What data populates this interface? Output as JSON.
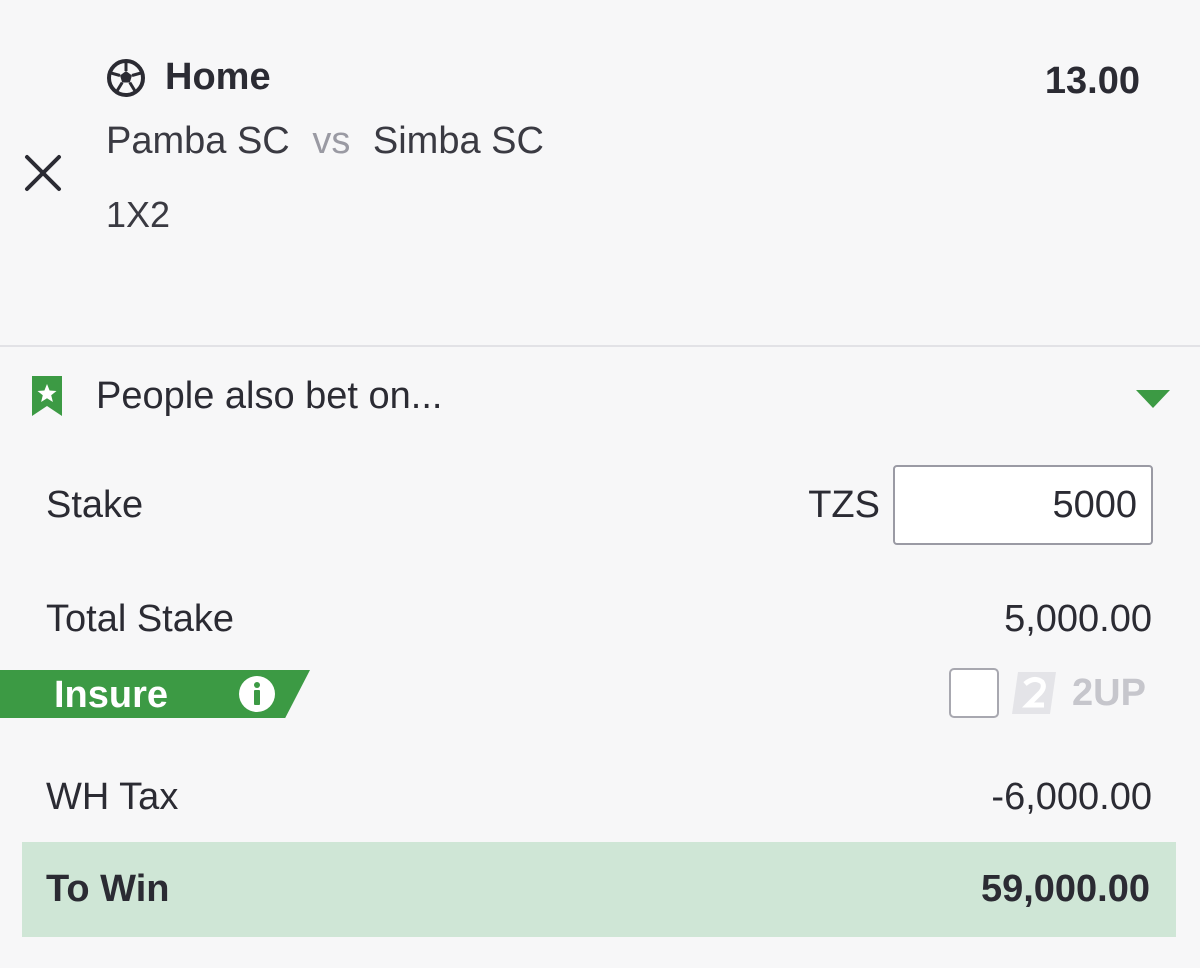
{
  "selection": {
    "sport_icon": "soccer-ball-icon",
    "pick": "Home",
    "odds": "13.00",
    "home_team": "Pamba SC",
    "vs": "vs",
    "away_team": "Simba SC",
    "market": "1X2",
    "close_icon": "close-icon"
  },
  "people_also_bet": {
    "label": "People also bet on...",
    "icon": "bookmark-star-icon",
    "caret_icon": "caret-down-icon"
  },
  "stake": {
    "label": "Stake",
    "currency": "TZS",
    "value": "5000"
  },
  "total_stake": {
    "label": "Total Stake",
    "value": "5,000.00"
  },
  "insure": {
    "label": "Insure",
    "info_icon": "info-icon"
  },
  "two_up": {
    "label": "2UP",
    "checked": false
  },
  "wh_tax": {
    "label": "WH Tax",
    "value": "-6,000.00"
  },
  "to_win": {
    "label": "To Win",
    "value": "59,000.00"
  },
  "colors": {
    "accent_green": "#3c9a44",
    "to_win_bg": "#cfe6d6",
    "text": "#2b2b33",
    "muted": "#9a9aa3"
  }
}
